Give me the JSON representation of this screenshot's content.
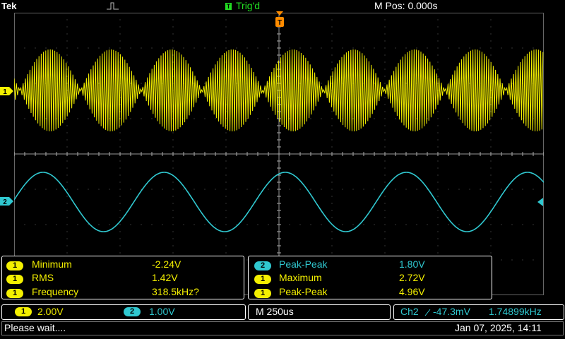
{
  "header": {
    "brand": "Tek",
    "trigger_status": "Trig'd",
    "trigger_badge": "T",
    "horizontal_position": "M Pos: 0.000s"
  },
  "channel_markers": {
    "ch1": "1",
    "ch2": "2",
    "trigger_marker": "T"
  },
  "measurements_left": [
    {
      "channel": "1",
      "name": "Minimum",
      "value": "-2.24V"
    },
    {
      "channel": "1",
      "name": "RMS",
      "value": "1.42V"
    },
    {
      "channel": "1",
      "name": "Frequency",
      "value": "318.5kHz?"
    }
  ],
  "measurements_right": [
    {
      "channel": "2",
      "name": "Peak-Peak",
      "value": "1.80V"
    },
    {
      "channel": "1",
      "name": "Maximum",
      "value": "2.72V"
    },
    {
      "channel": "1",
      "name": "Peak-Peak",
      "value": "4.96V"
    }
  ],
  "vertical": {
    "ch1_label": "1",
    "ch1_scale": "2.00V",
    "ch2_label": "2",
    "ch2_scale": "1.00V"
  },
  "timebase": "M 250us",
  "trigger_readout": {
    "source": "Ch2",
    "slope_icon": "rising-edge-icon",
    "level": "-47.3mV",
    "frequency": "1.74899kHz"
  },
  "status": {
    "message": "Please wait....",
    "datetime": "Jan 07, 2025, 14:11"
  },
  "colors": {
    "ch1": "#f4f000",
    "ch2": "#30c8d0",
    "trigger": "#ff8c00",
    "grid": "#555555",
    "status_green": "#22dd22"
  }
}
